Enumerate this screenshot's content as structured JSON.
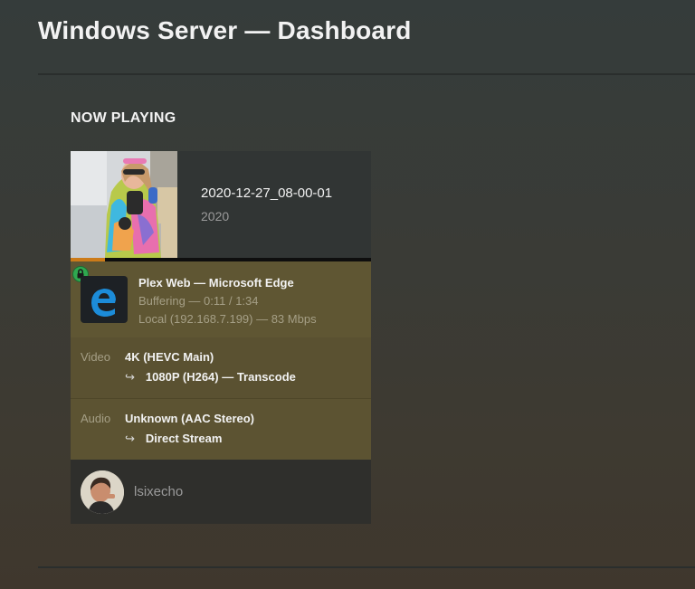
{
  "header": {
    "title": "Windows Server — Dashboard"
  },
  "section": {
    "title": "NOW PLAYING"
  },
  "now_playing": {
    "media": {
      "title": "2020-12-27_08-00-01",
      "year": "2020"
    },
    "progress_fraction": 0.115,
    "player": {
      "line1": "Plex Web  —  Microsoft Edge",
      "line2": "Buffering — 0:11 / 1:34",
      "line3": "Local (192.168.7.199) — 83 Mbps"
    },
    "video": {
      "label": "Video",
      "source": "4K (HEVC Main)",
      "arrow": "↪",
      "target": "1080P (H264) — Transcode"
    },
    "audio": {
      "label": "Audio",
      "source": "Unknown (AAC Stereo)",
      "arrow": "↪",
      "target": "Direct Stream"
    },
    "user": {
      "name": "lsixecho"
    }
  },
  "icons": {
    "lock": "lock-icon",
    "app": "microsoft-edge-icon"
  },
  "colors": {
    "progress": "#cc7b19",
    "lock": "#2fa84f",
    "edge_blue": "#1c8cd9"
  }
}
